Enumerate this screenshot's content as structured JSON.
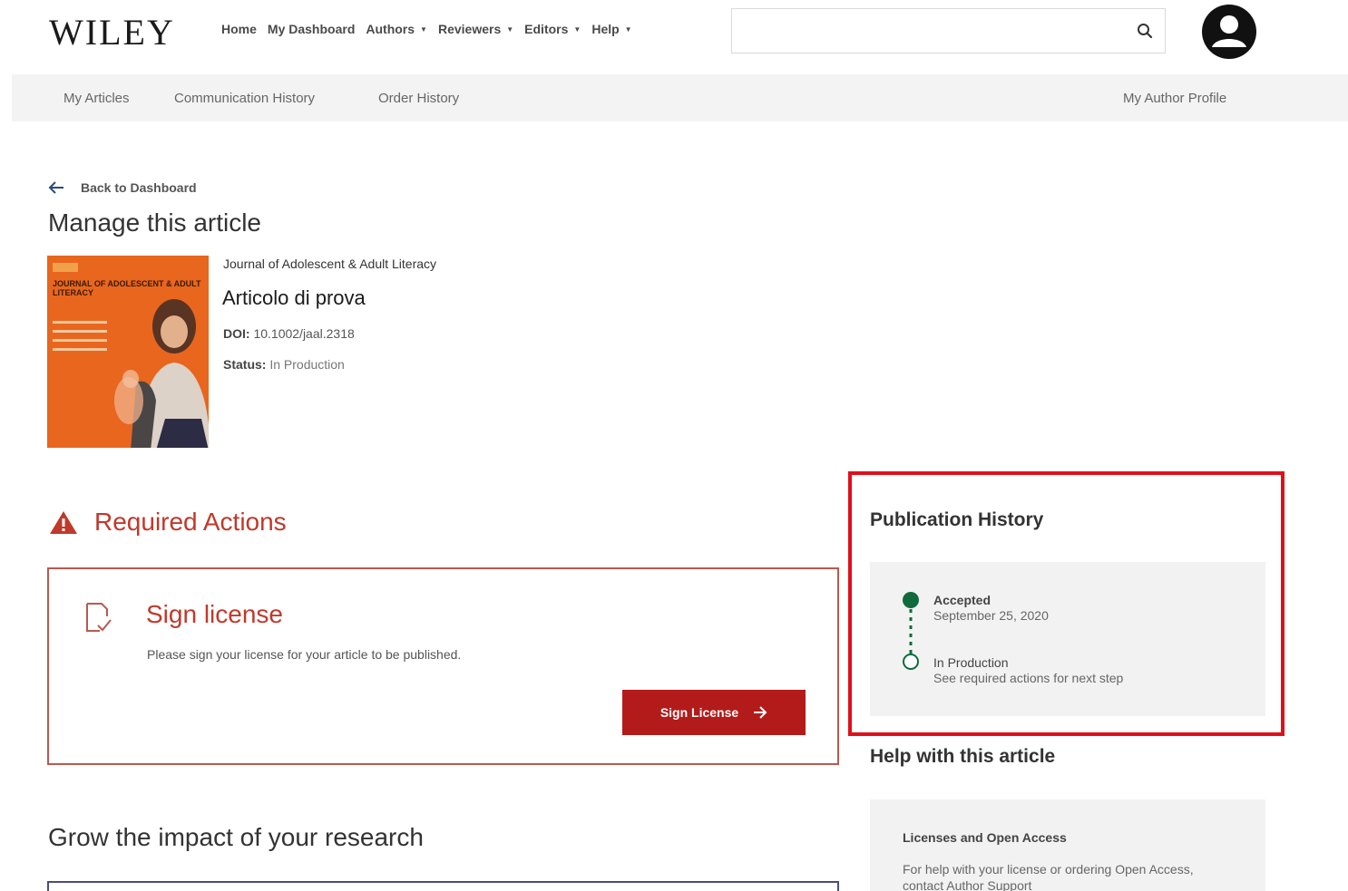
{
  "header": {
    "logo": "WILEY",
    "nav": [
      {
        "label": "Home",
        "has_caret": false
      },
      {
        "label": "My Dashboard",
        "has_caret": false
      },
      {
        "label": "Authors",
        "has_caret": true
      },
      {
        "label": "Reviewers",
        "has_caret": true
      },
      {
        "label": "Editors",
        "has_caret": true
      },
      {
        "label": "Help",
        "has_caret": true
      }
    ],
    "search": {
      "value": "",
      "placeholder": ""
    },
    "icons": {
      "search": "search-icon",
      "user": "user-avatar-icon"
    }
  },
  "subnav": {
    "items": [
      "My Articles",
      "Communication History",
      "Order History"
    ],
    "profile": "My Author Profile"
  },
  "article": {
    "back_label": "Back to Dashboard",
    "page_title": "Manage this article",
    "journal": "Journal of Adolescent & Adult Literacy",
    "cover_title": "Journal of Adolescent & Adult Literacy",
    "title": "Articolo di prova",
    "doi_label": "DOI:",
    "doi": "10.1002/jaal.2318",
    "status_label": "Status:",
    "status": "In Production"
  },
  "required_actions": {
    "heading": "Required Actions",
    "card": {
      "title": "Sign license",
      "description": "Please sign your license for your article to be published.",
      "button": "Sign License"
    }
  },
  "grow": {
    "heading": "Grow the impact of your research"
  },
  "publication_history": {
    "heading": "Publication History",
    "events": [
      {
        "status": "Accepted",
        "detail": "September 25, 2020"
      },
      {
        "status": "In Production",
        "detail": "See required actions for next step"
      }
    ]
  },
  "help": {
    "heading": "Help with this article",
    "card_title": "Licenses and Open Access",
    "card_desc": "For help with your license or ordering Open Access, contact Author Support"
  },
  "colors": {
    "accent_red": "#b31b1b",
    "highlight": "#e0101a",
    "timeline_green": "#0f6b3c",
    "cover_orange": "#e8661e"
  }
}
